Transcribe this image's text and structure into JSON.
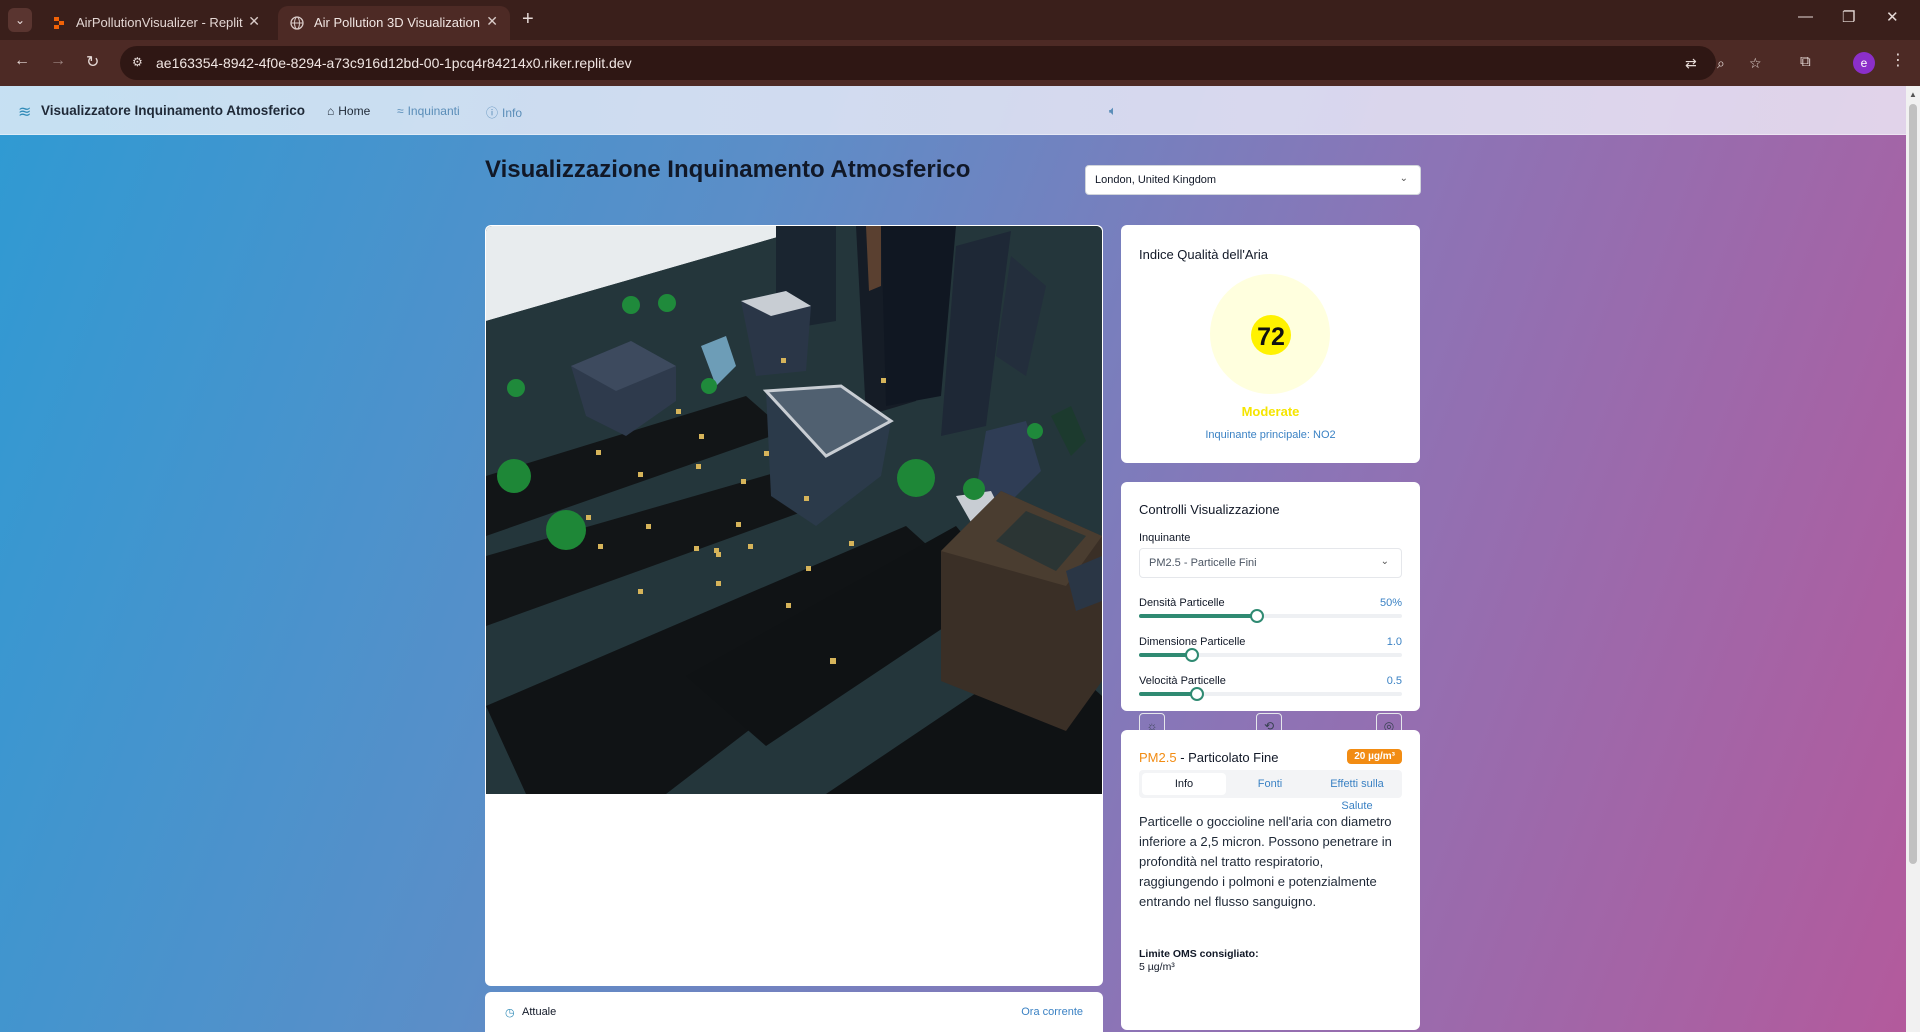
{
  "browser": {
    "tabs": [
      {
        "title": "AirPollutionVisualizer - Replit",
        "icon": "replit-icon",
        "active": false
      },
      {
        "title": "Air Pollution 3D Visualization",
        "icon": "globe-icon",
        "active": true
      }
    ],
    "url": "ae163354-8942-4f0e-8294-a73c916d12bd-00-1pcq4r84214x0.riker.replit.dev",
    "profile_initial": "e"
  },
  "nav": {
    "brand": "Visualizzatore Inquinamento Atmosferico",
    "links": {
      "home": "Home",
      "inquinanti": "Inquinanti",
      "info": "Info"
    }
  },
  "page": {
    "title": "Visualizzazione Inquinamento Atmosferico",
    "city": "London, United Kingdom"
  },
  "aqi": {
    "title": "Indice Qualità dell'Aria",
    "value": "72",
    "category": "Moderate",
    "main_pollutant": "Inquinante principale: NO2",
    "colors": {
      "core": "#fff200",
      "halo": "#ffffde",
      "category": "#f5e500"
    }
  },
  "controls": {
    "title": "Controlli Visualizzazione",
    "pollutant_label": "Inquinante",
    "pollutant_value": "PM2.5 - Particelle Fini",
    "sliders": [
      {
        "label": "Densità Particelle",
        "value": "50%",
        "fraction": 0.45
      },
      {
        "label": "Dimensione Particelle",
        "value": "1.0",
        "fraction": 0.2
      },
      {
        "label": "Velocità Particelle",
        "value": "0.5",
        "fraction": 0.22
      }
    ],
    "icons": [
      "sun-icon",
      "camera-rotate-icon",
      "target-icon"
    ]
  },
  "pollutant_info": {
    "code": "PM2.5",
    "name": " - Particolato Fine",
    "badge": "20 µg/m³",
    "tabs": [
      "Info",
      "Fonti",
      "Effetti sulla Salute"
    ],
    "active_tab": "Info",
    "description": "Particelle o goccioline nell'aria con diametro inferiore a 2,5 micron. Possono penetrare in profondità nel tratto respiratorio, raggiungendo i polmoni e potenzialmente entrando nel flusso sanguigno.",
    "who_label": "Limite OMS consigliato:",
    "who_value": "5 µg/m³",
    "accent_color": "#f28c13"
  },
  "timeline": {
    "label": "Attuale",
    "right": "Ora corrente"
  }
}
